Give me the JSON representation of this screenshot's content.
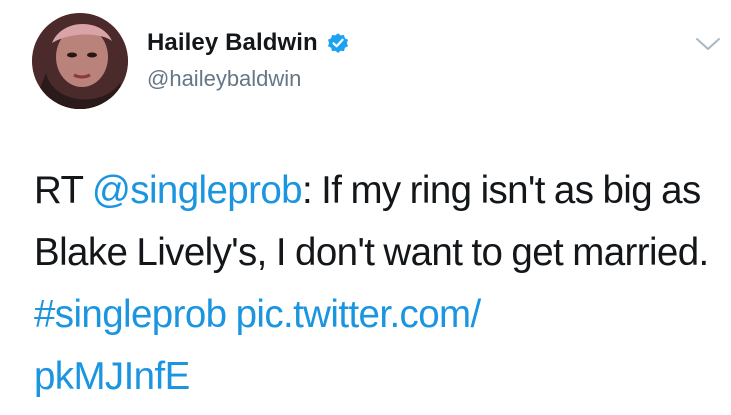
{
  "user": {
    "display_name": "Hailey Baldwin",
    "handle": "@haileybaldwin",
    "verified": true,
    "avatar_icon": "profile-avatar"
  },
  "menu": {
    "icon": "chevron-down-icon"
  },
  "tweet": {
    "prefix": "RT ",
    "mention": "@singleprob",
    "body": ": If my ring isn't as big as Blake Lively's, I don't want to get married. ",
    "hashtag": "#singleprob",
    "link_line1": "pic.twitter.com/",
    "link_line2": "pkMJInfE"
  },
  "colors": {
    "link": "#1b95e0",
    "text": "#14171a",
    "secondary": "#657786",
    "verified": "#1da1f2"
  }
}
